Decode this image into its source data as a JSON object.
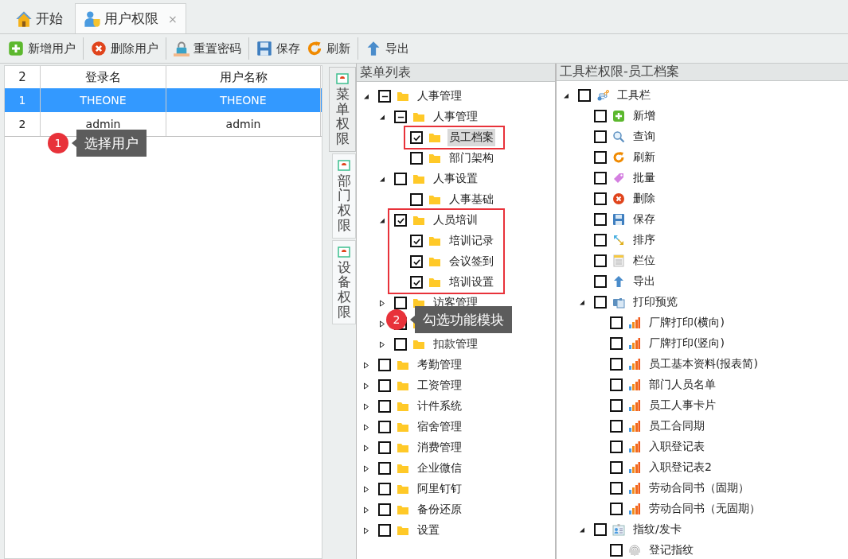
{
  "tabs": [
    {
      "label": "开始",
      "kind": "home",
      "selected": false
    },
    {
      "label": "用户权限",
      "kind": "user",
      "selected": true,
      "close": "×"
    }
  ],
  "toolbar": [
    {
      "label": "新增用户",
      "kind": "add",
      "separator_after": true
    },
    {
      "label": "删除用户",
      "kind": "delete",
      "separator_after": true
    },
    {
      "label": "重置密码",
      "kind": "lock",
      "separator_after": true
    },
    {
      "label": "保存",
      "kind": "save",
      "separator_after": false
    },
    {
      "label": "刷新",
      "kind": "refresh",
      "separator_after": true
    },
    {
      "label": "导出",
      "kind": "export",
      "separator_after": false
    },
    {
      "kind": "clipped"
    }
  ],
  "users_table": {
    "columns": [
      "2",
      "登录名",
      "用户名称"
    ],
    "rows": [
      {
        "cells": [
          "1",
          "THEONE",
          "THEONE"
        ],
        "selected": true
      },
      {
        "cells": [
          "2",
          "admin",
          "admin"
        ],
        "selected": false
      }
    ]
  },
  "side_tabs": [
    {
      "label": "菜单权限",
      "selected": true
    },
    {
      "label": "部门权限",
      "selected": false
    },
    {
      "label": "设备权限",
      "selected": false
    }
  ],
  "menu_tree": {
    "title": "菜单列表",
    "nodes": [
      {
        "label": "人事管理",
        "checked": false,
        "partial": true,
        "expanded": true,
        "selected": false,
        "highlighted": false,
        "children": [
          {
            "label": "人事管理",
            "checked": false,
            "partial": true,
            "expanded": true,
            "selected": false,
            "highlighted": false,
            "children": [
              {
                "label": "员工档案",
                "checked": true,
                "partial": false,
                "selected": true,
                "highlighted": true
              },
              {
                "label": "部门架构",
                "checked": false,
                "partial": false,
                "selected": false,
                "highlighted": false
              }
            ]
          },
          {
            "label": "人事设置",
            "checked": false,
            "partial": false,
            "expanded": true,
            "selected": false,
            "highlighted": false,
            "children": [
              {
                "label": "人事基础",
                "checked": false,
                "partial": false,
                "selected": false,
                "highlighted": false
              }
            ]
          },
          {
            "label": "人员培训",
            "checked": true,
            "partial": false,
            "expanded": true,
            "selected": false,
            "highlighted": true,
            "children": [
              {
                "label": "培训记录",
                "checked": true,
                "partial": false,
                "selected": false,
                "highlighted": false
              },
              {
                "label": "会议签到",
                "checked": true,
                "partial": false,
                "selected": false,
                "highlighted": false
              },
              {
                "label": "培训设置",
                "checked": true,
                "partial": false,
                "selected": false,
                "highlighted": false
              }
            ]
          },
          {
            "label": "访客管理",
            "checked": false,
            "partial": false,
            "expanded": false,
            "selected": false,
            "highlighted": false
          },
          {
            "expanded": false
          },
          {
            "label": "扣款管理",
            "checked": false,
            "partial": false,
            "expanded": false,
            "selected": false,
            "highlighted": false
          }
        ]
      },
      {
        "label": "考勤管理",
        "checked": false,
        "partial": false,
        "expanded": false,
        "selected": false,
        "highlighted": false
      },
      {
        "label": "工资管理",
        "checked": false,
        "partial": false,
        "expanded": false,
        "selected": false,
        "highlighted": false
      },
      {
        "label": "计件系统",
        "checked": false,
        "partial": false,
        "expanded": false,
        "selected": false,
        "highlighted": false
      },
      {
        "label": "宿舍管理",
        "checked": false,
        "partial": false,
        "expanded": false,
        "selected": false,
        "highlighted": false
      },
      {
        "label": "消费管理",
        "checked": false,
        "partial": false,
        "expanded": false,
        "selected": false,
        "highlighted": false
      },
      {
        "label": "企业微信",
        "checked": false,
        "partial": false,
        "expanded": false,
        "selected": false,
        "highlighted": false
      },
      {
        "label": "阿里钉钉",
        "checked": false,
        "partial": false,
        "expanded": false,
        "selected": false,
        "highlighted": false
      },
      {
        "label": "备份还原",
        "checked": false,
        "partial": false,
        "expanded": false,
        "selected": false,
        "highlighted": false
      },
      {
        "label": "设置",
        "checked": false,
        "partial": false,
        "expanded": false,
        "selected": false,
        "highlighted": false
      }
    ]
  },
  "toolbar_tree": {
    "title": "工具栏权限-员工档案",
    "nodes": [
      {
        "label": "工具栏",
        "kind": "toolbar",
        "checked": false,
        "expanded": true,
        "children": [
          {
            "label": "新增",
            "kind": "add",
            "checked": false
          },
          {
            "label": "查询",
            "kind": "search",
            "checked": false
          },
          {
            "label": "刷新",
            "kind": "refresh",
            "checked": false
          },
          {
            "label": "批量",
            "kind": "tag",
            "checked": false
          },
          {
            "label": "删除",
            "kind": "delete",
            "checked": false
          },
          {
            "label": "保存",
            "kind": "save",
            "checked": false
          },
          {
            "label": "排序",
            "kind": "sort",
            "checked": false
          },
          {
            "label": "栏位",
            "kind": "columns",
            "checked": false
          },
          {
            "label": "导出",
            "kind": "export",
            "checked": false
          },
          {
            "label": "打印预览",
            "kind": "print",
            "checked": false,
            "expanded": true,
            "children": [
              {
                "label": "厂牌打印(横向)",
                "kind": "report",
                "checked": false
              },
              {
                "label": "厂牌打印(竖向)",
                "kind": "report",
                "checked": false
              },
              {
                "label": "员工基本资料(报表简)",
                "kind": "report",
                "checked": false
              },
              {
                "label": "部门人员名单",
                "kind": "report",
                "checked": false
              },
              {
                "label": "员工人事卡片",
                "kind": "report",
                "checked": false
              },
              {
                "label": "员工合同期",
                "kind": "report",
                "checked": false
              },
              {
                "label": "入职登记表",
                "kind": "report",
                "checked": false
              },
              {
                "label": "入职登记表2",
                "kind": "report",
                "checked": false
              },
              {
                "label": "劳动合同书（固期）",
                "kind": "report",
                "checked": false
              },
              {
                "label": "劳动合同书（无固期）",
                "kind": "report",
                "checked": false
              }
            ]
          },
          {
            "label": "指纹/发卡",
            "kind": "badge",
            "checked": false,
            "expanded": true,
            "children": [
              {
                "label": "登记指纹",
                "kind": "fingerprint",
                "checked": false
              }
            ]
          }
        ]
      }
    ]
  },
  "callouts": [
    {
      "number": "1",
      "text": "选择用户"
    },
    {
      "number": "2",
      "text": "勾选功能模块"
    }
  ]
}
